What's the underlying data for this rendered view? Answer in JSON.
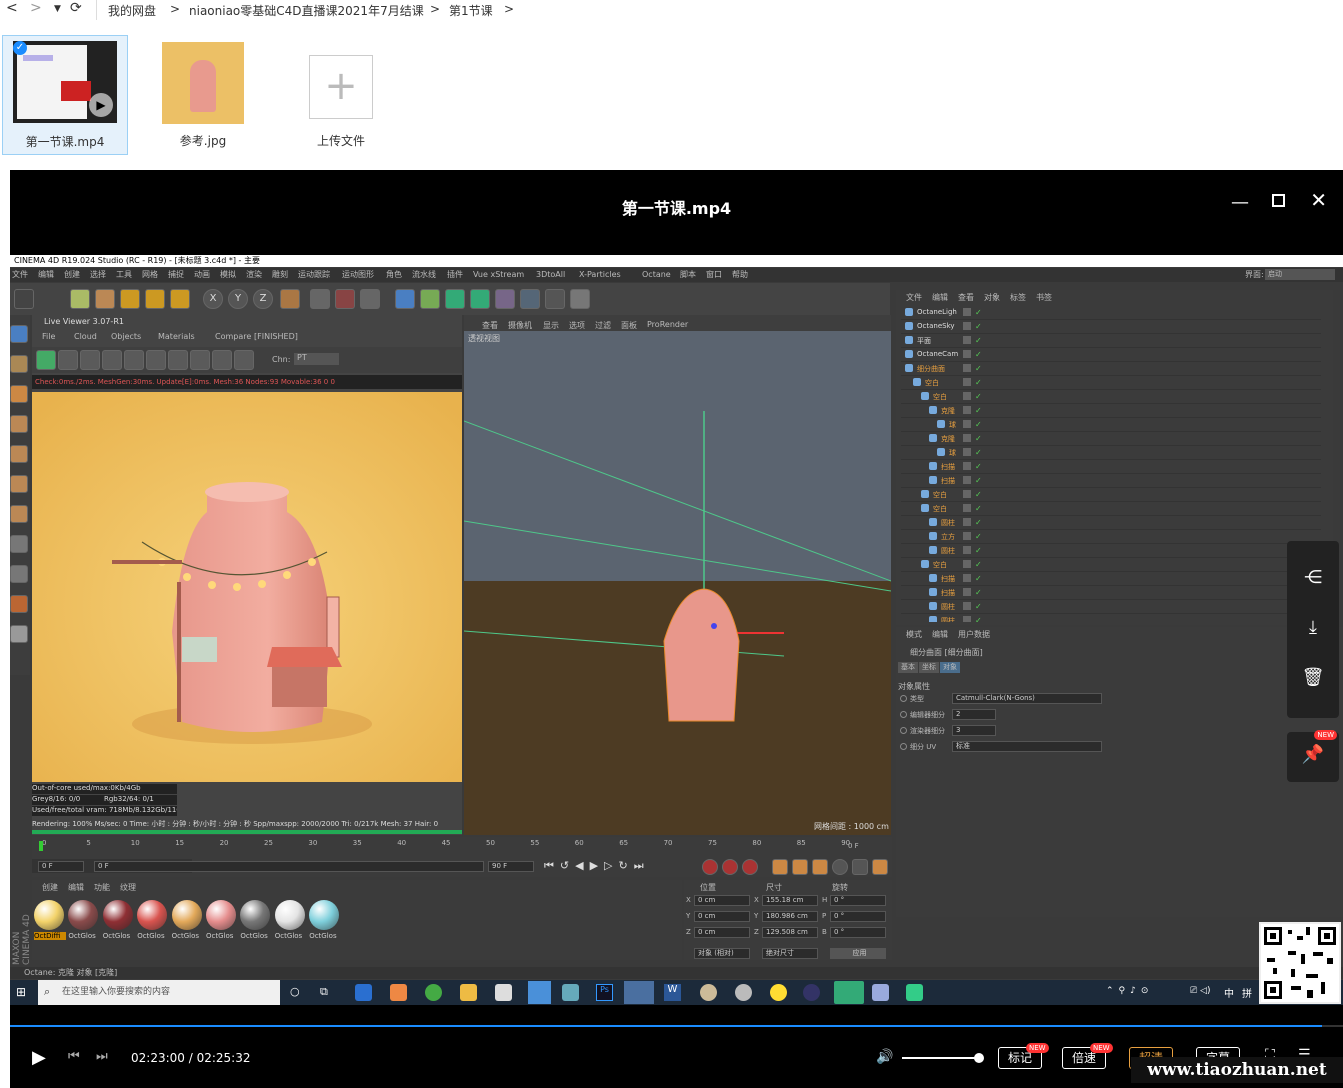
{
  "nav": {
    "back": "<",
    "forward": ">",
    "breadcrumb": [
      "我的网盘",
      "niaoniao零基础C4D直播课2021年7月结课",
      "第1节课"
    ],
    "sep": ">"
  },
  "files": [
    {
      "name": "第一节课.mp4",
      "selected": true
    },
    {
      "name": "参考.jpg",
      "selected": false
    },
    {
      "name": "上传文件",
      "selected": false
    }
  ],
  "player": {
    "title": "第一节课.mp4",
    "current_time": "02:23:00",
    "total_time": "02:25:32",
    "time_sep": " / ",
    "progress": 0.984,
    "buttons": {
      "mark": "标记",
      "speed": "倍速",
      "hd": "超清",
      "subtitle": "字幕"
    },
    "new_badge": "NEW"
  },
  "c4d": {
    "title_bar": "CINEMA 4D R19.024 Studio (RC - R19) - [未标题 3.c4d *] - 主要",
    "menu": [
      "文件",
      "编辑",
      "创建",
      "选择",
      "工具",
      "网格",
      "捕捉",
      "动画",
      "模拟",
      "渲染",
      "雕刻",
      "运动跟踪",
      "运动图形",
      "角色",
      "流水线",
      "插件",
      "Vue xStream",
      "3DtoAll",
      "X-Particles",
      "Octane",
      "脚本",
      "窗口",
      "帮助"
    ],
    "interface_label": "界面:",
    "interface_value": "启动",
    "live_viewer": {
      "title": "Live Viewer 3.07-R1",
      "menu": [
        "File",
        "Cloud",
        "Objects",
        "Materials",
        "Compare"
      ],
      "status": "[FINISHED]",
      "chn_label": "Chn:",
      "chn_value": "PT",
      "check": "Check:0ms./2ms. MeshGen:30ms. Update[E]:0ms. Mesh:36 Nodes:93 Movable:36  0 0",
      "ooc": "Out-of-core used/max:0Kb/4Gb",
      "grey": "Grey8/16: 0/0",
      "rgb": "Rgb32/64: 0/1",
      "vram": "Used/free/total vram: 718Mb/8.132Gb/11G",
      "rendering": "Rendering: 100%   Ms/sec: 0   Time: 小时 : 分钟 : 秒/小时 : 分钟 : 秒   Spp/maxspp: 2000/2000  Tri: 0/217k    Mesh: 37   Hair: 0"
    },
    "viewport": {
      "menu": [
        "查看",
        "摄像机",
        "显示",
        "选项",
        "过滤",
        "面板",
        "ProRender"
      ],
      "label": "透视视图",
      "grid": "网格间距 : 1000 cm"
    },
    "objects": {
      "menu": [
        "文件",
        "编辑",
        "查看",
        "对象",
        "标签",
        "书签"
      ],
      "items": [
        "OctaneLigh",
        "OctaneSky",
        "平面",
        "OctaneCam",
        "细分曲面",
        "空白",
        "空白",
        "克隆",
        "球",
        "克隆",
        "球",
        "扫描",
        "扫描",
        "空白",
        "空白",
        "圆柱",
        "立方",
        "圆柱",
        "空白",
        "扫描",
        "扫描",
        "圆柱",
        "圆柱"
      ]
    },
    "attributes": {
      "menu": [
        "模式",
        "编辑",
        "用户数据"
      ],
      "object": "细分曲面 [细分曲面]",
      "tabs": [
        "基本",
        "坐标",
        "对象"
      ],
      "section": "对象属性",
      "props": [
        {
          "label": "类型",
          "value": "Catmull-Clark(N-Gons)"
        },
        {
          "label": "编辑器细分",
          "value": "2"
        },
        {
          "label": "渲染器细分",
          "value": "3"
        },
        {
          "label": "细分 UV",
          "value": "标准"
        }
      ]
    },
    "timeline": {
      "ticks": [
        "0",
        "5",
        "10",
        "15",
        "20",
        "25",
        "30",
        "35",
        "40",
        "45",
        "50",
        "55",
        "60",
        "65",
        "70",
        "75",
        "80",
        "85",
        "90"
      ],
      "end_frame": "0 F",
      "start": "0 F",
      "range_start": "0 F",
      "range_end": "90 F",
      "max": "90 F"
    },
    "materials": {
      "menu": [
        "创建",
        "编辑",
        "功能",
        "纹理"
      ],
      "items": [
        {
          "name": "OctDiffi",
          "color": "#f3d36a"
        },
        {
          "name": "OctGlos",
          "color": "#8a4b4b"
        },
        {
          "name": "OctGlos",
          "color": "#8f2f34"
        },
        {
          "name": "OctGlos",
          "color": "#d9544f"
        },
        {
          "name": "OctGlos",
          "color": "#e3a95a"
        },
        {
          "name": "OctGlos",
          "color": "#e58d8d"
        },
        {
          "name": "OctGlos",
          "color": "#777777"
        },
        {
          "name": "OctGlos",
          "color": "#e4e4e4"
        },
        {
          "name": "OctGlos",
          "color": "#7fd0dc"
        }
      ]
    },
    "coords": {
      "headers": [
        "位置",
        "尺寸",
        "旋转"
      ],
      "rows": [
        {
          "axis": "X",
          "pos": "0 cm",
          "size_axis": "X",
          "size": "155.18 cm",
          "rot_axis": "H",
          "rot": "0 °"
        },
        {
          "axis": "Y",
          "pos": "0 cm",
          "size_axis": "Y",
          "size": "180.986 cm",
          "rot_axis": "P",
          "rot": "0 °"
        },
        {
          "axis": "Z",
          "pos": "0 cm",
          "size_axis": "Z",
          "size": "129.508 cm",
          "rot_axis": "B",
          "rot": "0 °"
        }
      ],
      "mode1": "对象 (相对)",
      "mode2": "绝对尺寸",
      "apply": "应用"
    },
    "statusbar": "Octane:     克隆 对象 [克隆]",
    "brand": "MAXON CINEMA 4D"
  },
  "taskbar": {
    "search_placeholder": "在这里输入你要搜索的内容",
    "tray": [
      "中",
      "拼"
    ]
  },
  "watermark": "www.tiaozhuan.net",
  "colors": {
    "accent": "#1a8cff",
    "c4d_bg": "#3a3a3a",
    "render_bg": "#f0c261",
    "ground": "#4d3b23",
    "sky": "#5b6470"
  }
}
